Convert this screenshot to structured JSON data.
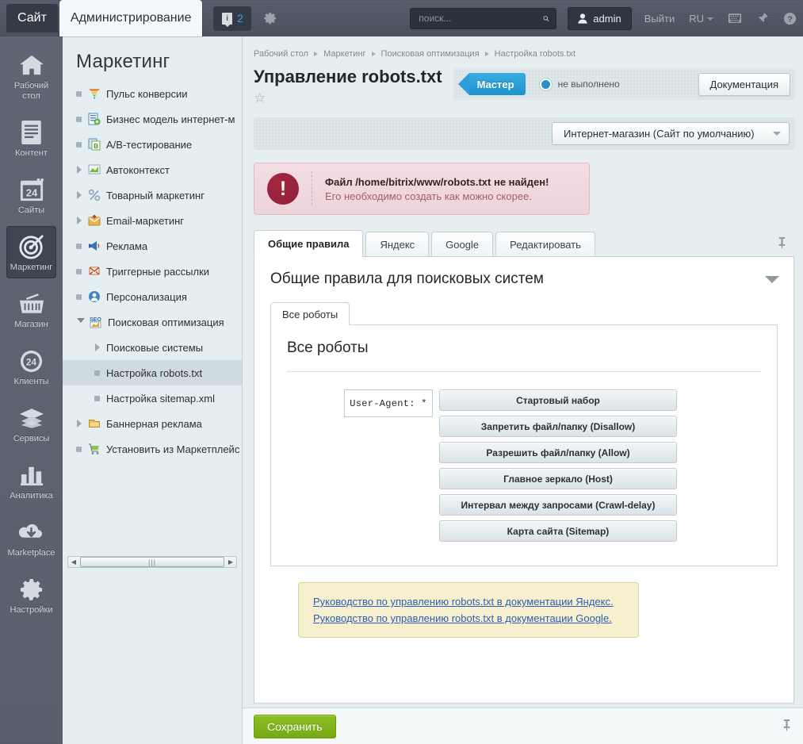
{
  "topbar": {
    "site_tab": "Сайт",
    "admin_tab": "Администрирование",
    "counter": "2",
    "counter_icon": "info-icon",
    "gear_icon": "gear-icon",
    "search_placeholder": "поиск...",
    "search_value": "",
    "search_icon": "search-icon",
    "user": "admin",
    "user_icon": "person-icon",
    "logout": "Выйти",
    "language": "RU",
    "keyboard_icon": "keyboard-icon",
    "pin_icon": "pin-icon",
    "help_icon": "help-icon"
  },
  "rail": {
    "items": [
      {
        "label": "Рабочий\nстол",
        "icon": "home-icon",
        "active": false
      },
      {
        "label": "Контент",
        "icon": "document-icon",
        "active": false
      },
      {
        "label": "Сайты",
        "icon": "sites-24-icon",
        "active": false
      },
      {
        "label": "Маркетинг",
        "icon": "target-icon",
        "active": true
      },
      {
        "label": "Магазин",
        "icon": "basket-icon",
        "active": false
      },
      {
        "label": "Клиенты",
        "icon": "clients-24-icon",
        "active": false
      },
      {
        "label": "Сервисы",
        "icon": "layers-icon",
        "active": false
      },
      {
        "label": "Аналитика",
        "icon": "bar-chart-icon",
        "active": false
      },
      {
        "label": "Marketplace",
        "icon": "cloud-download-icon",
        "active": false
      },
      {
        "label": "Настройки",
        "icon": "gear-icon",
        "active": false
      }
    ]
  },
  "menu": {
    "title": "Маркетинг",
    "items": [
      {
        "label": "Пульс конверсии",
        "marker": "bullet",
        "icon": "funnel-icon",
        "indent": 0,
        "selected": false
      },
      {
        "label": "Бизнес модель интернет-м",
        "marker": "bullet",
        "icon": "business-model-icon",
        "indent": 0,
        "selected": false
      },
      {
        "label": "A/B-тестирование",
        "marker": "bullet",
        "icon": "ab-test-icon",
        "indent": 0,
        "selected": false
      },
      {
        "label": "Автоконтекст",
        "marker": "arrow",
        "icon": "autocontext-icon",
        "indent": 0,
        "selected": false
      },
      {
        "label": "Товарный маркетинг",
        "marker": "arrow",
        "icon": "percent-icon",
        "indent": 0,
        "selected": false
      },
      {
        "label": "Email-маркетинг",
        "marker": "arrow",
        "icon": "email-icon",
        "indent": 0,
        "selected": false
      },
      {
        "label": "Реклама",
        "marker": "bullet",
        "icon": "megaphone-icon",
        "indent": 0,
        "selected": false
      },
      {
        "label": "Триггерные рассылки",
        "marker": "bullet",
        "icon": "trigger-mail-icon",
        "indent": 0,
        "selected": false
      },
      {
        "label": "Персонализация",
        "marker": "bullet",
        "icon": "personalization-icon",
        "indent": 0,
        "selected": false
      },
      {
        "label": "Поисковая оптимизация",
        "marker": "arrow-open",
        "icon": "seo-icon",
        "indent": 0,
        "selected": false
      },
      {
        "label": "Поисковые системы",
        "marker": "arrow",
        "icon": "none",
        "indent": 1,
        "selected": false
      },
      {
        "label": "Настройка robots.txt",
        "marker": "bullet",
        "icon": "none",
        "indent": 1,
        "selected": true
      },
      {
        "label": "Настройка sitemap.xml",
        "marker": "bullet",
        "icon": "none",
        "indent": 1,
        "selected": false
      },
      {
        "label": "Баннерная реклама",
        "marker": "arrow",
        "icon": "banner-icon",
        "indent": 0,
        "selected": false
      },
      {
        "label": "Установить из Маркетплейс",
        "marker": "bullet",
        "icon": "cart-icon",
        "indent": 0,
        "selected": false
      }
    ]
  },
  "content": {
    "breadcrumb": [
      "Рабочий стол",
      "Маркетинг",
      "Поисковая оптимизация",
      "Настройка robots.txt"
    ],
    "page_title": "Управление robots.txt",
    "favorite_icon": "star-icon",
    "wizard_button": "Мастер",
    "wizard_status": "не выполнено",
    "documentation_button": "Документация",
    "site_select_value": "Интернет-магазин (Сайт по умолчанию)",
    "alert": {
      "icon": "exclamation-icon",
      "title": "Файл /home/bitrix/www/robots.txt не найден!",
      "description": "Его необходимо создать как можно скорее."
    },
    "tabs": [
      {
        "label": "Общие правила",
        "active": true
      },
      {
        "label": "Яндекс",
        "active": false
      },
      {
        "label": "Google",
        "active": false
      },
      {
        "label": "Редактировать",
        "active": false
      }
    ],
    "pin_icon": "pin-icon",
    "panel_heading": "Общие правила для поисковых систем",
    "collapse_icon": "chevron-down-icon",
    "inner_tab": "Все роботы",
    "inner_title": "Все роботы",
    "user_agent_value": "User-Agent: *",
    "rule_buttons": [
      "Стартовый набор",
      "Запретить файл/папку (Disallow)",
      "Разрешить файл/папку (Allow)",
      "Главное зеркало (Host)",
      "Интервал между запросами (Crawl-delay)",
      "Карта сайта (Sitemap)"
    ],
    "note_links": [
      "Руководство по управлению robots.txt в документации Яндекс.",
      "Руководство по управлению robots.txt в документации Google."
    ]
  },
  "footer": {
    "save_button": "Сохранить",
    "pin_icon": "pin-icon"
  },
  "colors": {
    "accent_blue": "#2e9fd8",
    "save_green": "#82b71c",
    "alert_red": "#97243c",
    "topbar_dark": "#4a5260",
    "rail_dark": "#5b6371",
    "menu_bg": "#e5eef0",
    "link_blue": "#2b5fb3",
    "note_yellow": "#f6f0cf"
  }
}
